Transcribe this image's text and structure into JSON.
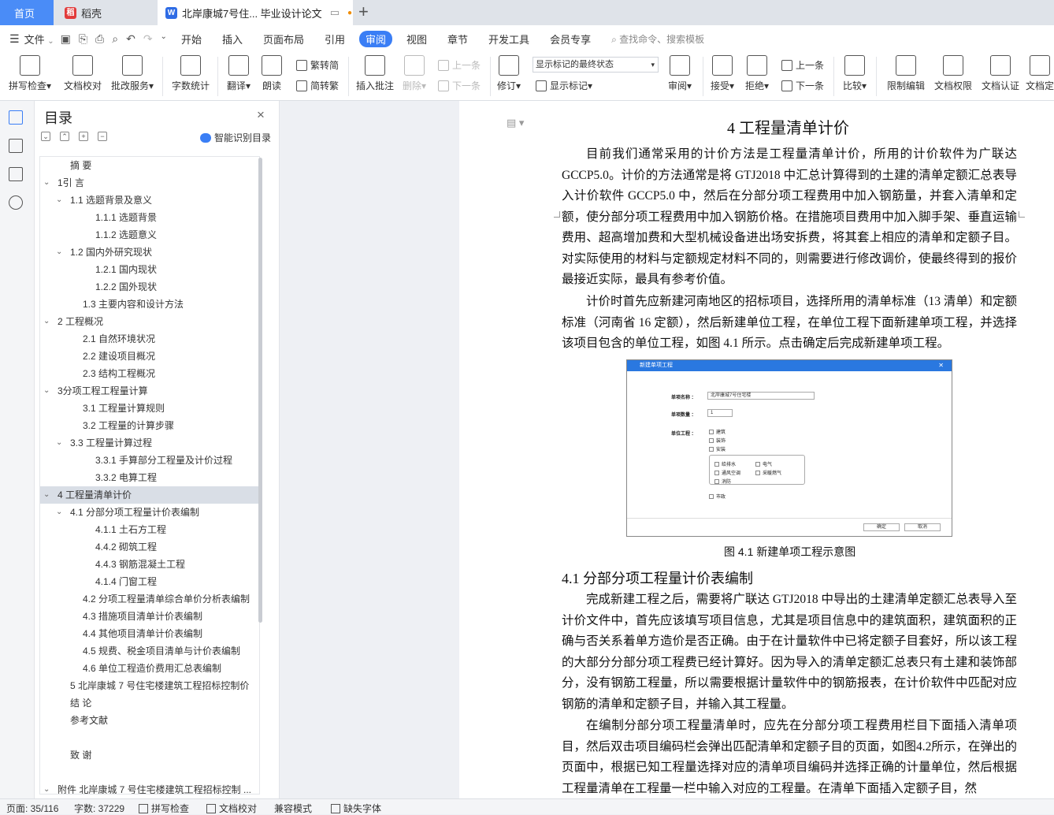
{
  "tabs": {
    "home": "首页",
    "daoke": "稻壳",
    "doc": "北岸康城7号住... 毕业设计论文"
  },
  "menu": {
    "file": "文件",
    "items": [
      "开始",
      "插入",
      "页面布局",
      "引用",
      "审阅",
      "视图",
      "章节",
      "开发工具",
      "会员专享"
    ],
    "search": "查找命令、搜索模板",
    "active": "审阅"
  },
  "ribbon": {
    "spell": "拼写检查",
    "proof": "文档校对",
    "annotate": "批改服务",
    "wordcount": "字数统计",
    "translate": "翻译",
    "read": "朗读",
    "trad": "繁转简",
    "simp": "简转繁",
    "insert_comment": "插入批注",
    "delete": "删除",
    "prev": "上一条",
    "next": "下一条",
    "revise": "修订",
    "markup_state": "显示标记的最终状态",
    "show_markup": "显示标记",
    "review": "审阅",
    "accept": "接受",
    "reject": "拒绝",
    "prev2": "上一条",
    "next2": "下一条",
    "compare": "比较",
    "restrict": "限制编辑",
    "permission": "文档权限",
    "certify": "文档认证",
    "finalize": "文档定"
  },
  "nav": {
    "title": "目录",
    "smart": "智能识别目录"
  },
  "toc": [
    {
      "label": "摘  要",
      "level": 1,
      "arrow": ""
    },
    {
      "label": "1引 言",
      "level": 0,
      "arrow": "v"
    },
    {
      "label": "1.1 选题背景及意义",
      "level": 1,
      "arrow": "v"
    },
    {
      "label": "1.1.1  选题背景",
      "level": 3,
      "arrow": ""
    },
    {
      "label": "1.1.2  选题意义",
      "level": 3,
      "arrow": ""
    },
    {
      "label": "1.2  国内外研究现状",
      "level": 1,
      "arrow": "v"
    },
    {
      "label": "1.2.1  国内现状",
      "level": 3,
      "arrow": ""
    },
    {
      "label": "1.2.2  国外现状",
      "level": 3,
      "arrow": ""
    },
    {
      "label": "1.3  主要内容和设计方法",
      "level": 2,
      "arrow": ""
    },
    {
      "label": "2  工程概况",
      "level": 0,
      "arrow": "v"
    },
    {
      "label": "2.1  自然环境状况",
      "level": 2,
      "arrow": ""
    },
    {
      "label": "2.2  建设项目概况",
      "level": 2,
      "arrow": ""
    },
    {
      "label": "2.3  结构工程概况",
      "level": 2,
      "arrow": ""
    },
    {
      "label": "3分项工程工程量计算",
      "level": 0,
      "arrow": "v"
    },
    {
      "label": "3.1  工程量计算规则",
      "level": 2,
      "arrow": ""
    },
    {
      "label": "3.2  工程量的计算步骤",
      "level": 2,
      "arrow": ""
    },
    {
      "label": "3.3  工程量计算过程",
      "level": 1,
      "arrow": "v"
    },
    {
      "label": "3.3.1  手算部分工程量及计价过程",
      "level": 3,
      "arrow": ""
    },
    {
      "label": "3.3.2  电算工程",
      "level": 3,
      "arrow": ""
    },
    {
      "label": "4  工程量清单计价",
      "level": 0,
      "arrow": "v",
      "selected": true
    },
    {
      "label": "4.1  分部分项工程量计价表编制",
      "level": 1,
      "arrow": "v"
    },
    {
      "label": "4.1.1  土石方工程",
      "level": 3,
      "arrow": ""
    },
    {
      "label": "4.4.2  砌筑工程",
      "level": 3,
      "arrow": ""
    },
    {
      "label": "4.4.3  钢筋混凝土工程",
      "level": 3,
      "arrow": ""
    },
    {
      "label": "4.1.4  门窗工程",
      "level": 3,
      "arrow": ""
    },
    {
      "label": "4.2  分项工程量清单综合单价分析表编制",
      "level": 2,
      "arrow": ""
    },
    {
      "label": "4.3  措施项目清单计价表编制",
      "level": 2,
      "arrow": ""
    },
    {
      "label": "4.4  其他项目清单计价表编制",
      "level": 2,
      "arrow": ""
    },
    {
      "label": "4.5  规费、税金项目清单与计价表编制",
      "level": 2,
      "arrow": ""
    },
    {
      "label": "4.6  单位工程造价费用汇总表编制",
      "level": 2,
      "arrow": ""
    },
    {
      "label": "5 北岸康城 7 号住宅楼建筑工程招标控制价",
      "level": 1,
      "arrow": ""
    },
    {
      "label": "结  论",
      "level": 1,
      "arrow": ""
    },
    {
      "label": "参考文献",
      "level": 1,
      "arrow": ""
    },
    {
      "label": "",
      "level": 1,
      "arrow": ""
    },
    {
      "label": "致  谢",
      "level": 1,
      "arrow": ""
    },
    {
      "label": "",
      "level": 1,
      "arrow": ""
    },
    {
      "label": "附件  北岸康城 7 号住宅楼建筑工程招标控制 ...",
      "level": 0,
      "arrow": "v"
    }
  ],
  "doc": {
    "heading": "4    工程量清单计价",
    "p1": "目前我们通常采用的计价方法是工程量清单计价，所用的计价软件为广联达GCCP5.0。计价的方法通常是将 GTJ2018 中汇总计算得到的土建的清单定额汇总表导入计价软件 GCCP5.0 中，然后在分部分项工程费用中加入钢筋量，并套入清单和定额，使分部分项工程费用中加入钢筋价格。在措施项目费用中加入脚手架、垂直运输费用、超高增加费和大型机械设备进出场安拆费，将其套上相应的清单和定额子目。对实际使用的材料与定额规定材料不同的，则需要进行修改调价，使最终得到的报价最接近实际，最具有参考价值。",
    "p2": "计价时首先应新建河南地区的招标项目，选择所用的清单标准（13 清单）和定额标准（河南省 16 定额），然后新建单位工程，在单位工程下面新建单项工程，并选择该项目包含的单位工程，如图 4.1 所示。点击确定后完成新建单项工程。",
    "figcap": "图 4.1  新建单项工程示意图",
    "h2": "4.1   分部分项工程量计价表编制",
    "p3": "完成新建工程之后，需要将广联达 GTJ2018 中导出的土建清单定额汇总表导入至计价文件中，首先应该填写项目信息，尤其是项目信息中的建筑面积，建筑面积的正确与否关系着单方造价是否正确。由于在计量软件中已将定额子目套好，所以该工程的大部分分部分项工程费已经计算好。因为导入的清单定额汇总表只有土建和装饰部分，没有钢筋工程量，所以需要根据计量软件中的钢筋报表，在计价软件中匹配对应钢筋的清单和定额子目，并输入其工程量。",
    "p4": "在编制分部分项工程量清单时，应先在分部分项工程费用栏目下面插入清单项目，然后双击项目编码栏会弹出匹配清单和定额子目的页面，如图4.2所示，在弹出的页面中，根据已知工程量选择对应的清单项目编码并选择正确的计量单位，然后根据工程量清单在工程量一栏中输入对应的工程量。在清单下面插入定额子目，然"
  },
  "figure": {
    "title": "新建单项工程",
    "name_label": "单项名称 ：",
    "name_value": "北岸康城7号住宅楼",
    "count_label": "单项数量 ：",
    "count_value": "1",
    "unit_label": "单位工程 ：",
    "opt1": "建筑",
    "opt2": "装饰",
    "opt3": "安装",
    "sub1": "给排水",
    "sub2": "电气",
    "sub3": "通风空调",
    "sub4": "采暖燃气",
    "sub5": "消防",
    "opt4": "市政",
    "ok": "确定",
    "cancel": "取消"
  },
  "status": {
    "page": "页面: 35/116",
    "words": "字数: 37229",
    "spell": "拼写检查",
    "proof": "文档校对",
    "compat": "兼容模式",
    "font": "缺失字体"
  }
}
